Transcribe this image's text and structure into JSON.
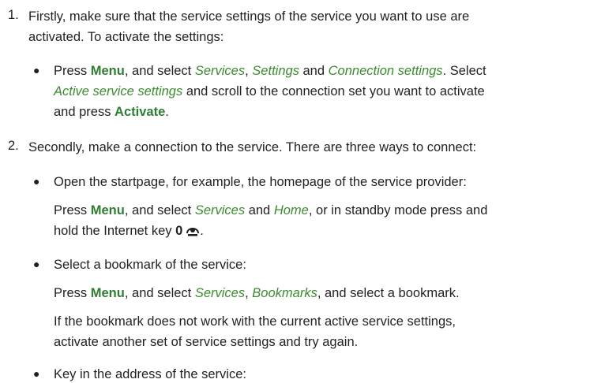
{
  "colors": {
    "text": "#231f20",
    "key": "#2e7d32",
    "option": "#3a8a2e"
  },
  "step1": {
    "number": "1.",
    "line1": "Firstly, make sure that the service settings of the service you want to use are",
    "line2": "activated. To activate the settings:",
    "bullet": {
      "t1": "Press ",
      "k1": "Menu",
      "t2": ", and select ",
      "o1": "Services",
      "t3": ", ",
      "o2": "Settings",
      "t4": " and ",
      "o3": "Connection settings",
      "t5": ". Select",
      "o4": "Active service settings",
      "t6": " and scroll to the connection set you want to activate",
      "t7": "and press ",
      "k2": "Activate",
      "t8": "."
    }
  },
  "step2": {
    "number": "2.",
    "line1": "Secondly, make a connection to the service. There are three ways to connect:",
    "bullet1": {
      "text": "Open the startpage, for example, the homepage of the service provider:",
      "t1": "Press ",
      "k1": "Menu",
      "t2": ", and select ",
      "o1": "Services",
      "t3": " and ",
      "o2": "Home",
      "t4": ", or in standby mode press and",
      "t5": "hold the Internet key ",
      "key_zero": "0",
      "t6": "."
    },
    "bullet2": {
      "text": "Select a bookmark of the service:",
      "t1": "Press ",
      "k1": "Menu",
      "t2": ", and select ",
      "o1": "Services",
      "t3": ", ",
      "o2": "Bookmarks",
      "t4": ", and select a bookmark.",
      "note1": "If the bookmark does not work with the current active service settings,",
      "note2": "activate another set of service settings and try again."
    },
    "bullet3": {
      "text": "Key in the address of the service:"
    }
  },
  "icons": {
    "internet_key": "internet-globe-icon",
    "bullet": "bullet-dot-icon"
  }
}
